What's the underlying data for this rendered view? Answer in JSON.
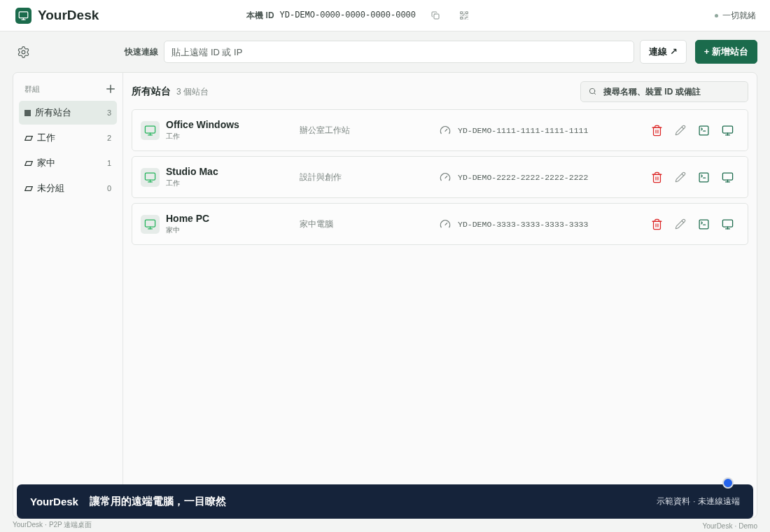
{
  "app": {
    "name": "YourDesk",
    "device_id_label": "本機 ID",
    "device_id": "YD-DEMO-0000-0000-0000-0000",
    "status": "一切就緒"
  },
  "quick_connect": {
    "label": "快速連線",
    "placeholder": "貼上遠端 ID 或 IP",
    "connect_button": "連線 ↗",
    "add_button": "+ 新增站台"
  },
  "sidebar": {
    "title": "群組",
    "items": [
      {
        "label": "所有站台",
        "count": "3",
        "selected": true
      },
      {
        "label": "工作",
        "count": "2",
        "selected": false
      },
      {
        "label": "家中",
        "count": "1",
        "selected": false
      },
      {
        "label": "未分組",
        "count": "0",
        "selected": false
      }
    ]
  },
  "list": {
    "title": "所有站台",
    "count": "3 個站台",
    "search_placeholder": "搜尋名稱、裝置 ID 或備註",
    "rows": [
      {
        "name": "Office Windows",
        "group": "工作",
        "note": "辦公室工作站",
        "id": "YD-DEMO-1111-1111-1111-1111"
      },
      {
        "name": "Studio Mac",
        "group": "工作",
        "note": "設計與創作",
        "id": "YD-DEMO-2222-2222-2222-2222"
      },
      {
        "name": "Home PC",
        "group": "家中",
        "note": "家中電腦",
        "id": "YD-DEMO-3333-3333-3333-3333"
      }
    ]
  },
  "banner": {
    "brand": "YourDesk",
    "headline": "讓常用的遠端電腦，一目瞭然",
    "note": "示範資料 · 未連線遠端"
  },
  "footer": {
    "left": "YourDesk · P2P 遠端桌面",
    "right": "YourDesk · Demo"
  }
}
